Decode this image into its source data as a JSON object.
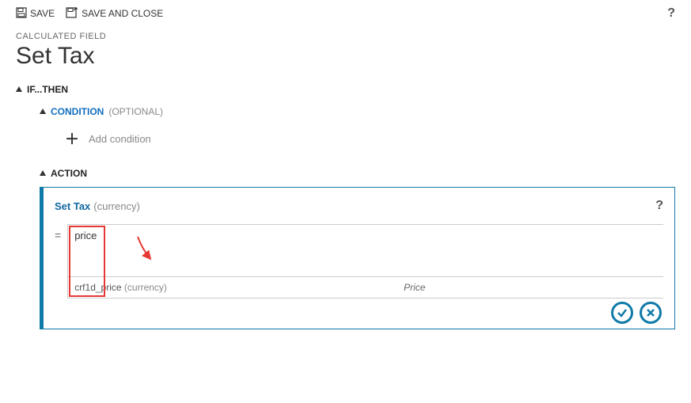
{
  "toolbar": {
    "save_label": "SAVE",
    "save_close_label": "SAVE AND CLOSE"
  },
  "page": {
    "subtitle": "CALCULATED FIELD",
    "title": "Set Tax"
  },
  "ifthen": {
    "label": "IF...THEN"
  },
  "condition": {
    "label": "CONDITION",
    "optional": "(OPTIONAL)",
    "add_label": "Add condition"
  },
  "action": {
    "label": "ACTION",
    "panel_title": "Set Tax",
    "panel_type": "(currency)",
    "input_value": "price",
    "suggestion_field": "crf1d_price",
    "suggestion_type": "(currency)",
    "suggestion_display": "Price"
  }
}
